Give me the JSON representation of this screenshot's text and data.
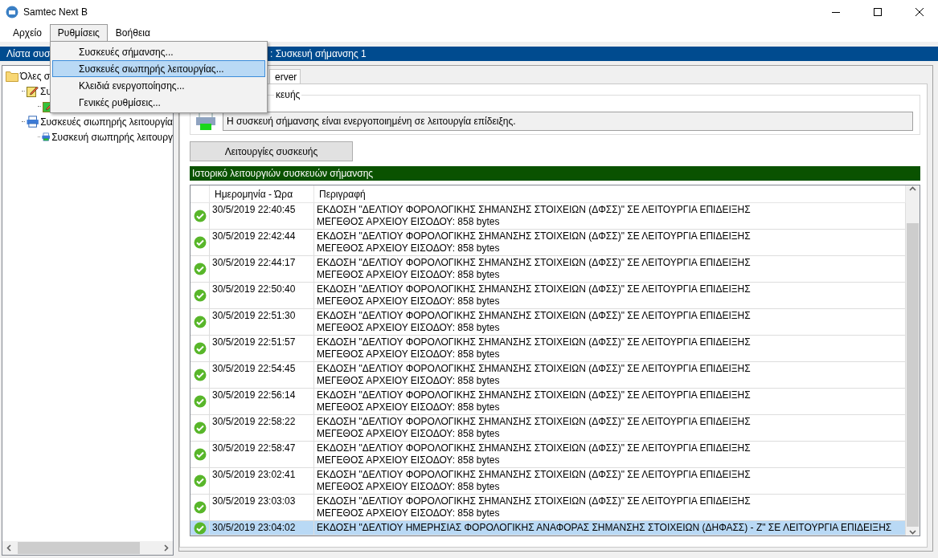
{
  "window": {
    "title": "Samtec Next B"
  },
  "menubar": [
    {
      "label": "Αρχείο",
      "selected": false
    },
    {
      "label": "Ρυθμίσεις",
      "selected": true
    },
    {
      "label": "Βοήθεια",
      "selected": false
    }
  ],
  "open_menu": [
    {
      "label": "Συσκευές σήμανσης...",
      "selected": false
    },
    {
      "label": "Συσκευές σιωπηρής λειτουργίας...",
      "selected": true
    },
    {
      "label": "Κλειδιά ενεργοποίησης...",
      "selected": false
    },
    {
      "label": "Γενικές ρυθμίσεις...",
      "selected": false
    }
  ],
  "left_panel": {
    "header": "Λίστα συσ",
    "tree": [
      {
        "label": "Όλες σ",
        "kind": "folder",
        "children": [
          {
            "label": "Συ",
            "kind": "note",
            "children": [
              {
                "kind": "note-green"
              }
            ]
          },
          {
            "label": "Συσκευές σιωπηρής λειτουργία",
            "kind": "printer",
            "children": [
              {
                "label": "Συσκευή σιωπηρής λειτουργ",
                "kind": "printer-green"
              }
            ]
          }
        ]
      }
    ]
  },
  "right_panel": {
    "header": ": Συσκευή σήμανσης 1",
    "tabs": [
      {
        "label": "erver",
        "selected": true
      }
    ],
    "group": {
      "label": "κευής",
      "message": "Η συσκευή σήμανσης είναι ενεργοποιημένη σε λειτουργία επίδειξης."
    },
    "button": "Λειτουργίες συσκευής",
    "history": {
      "title": "Ιστορικό λειτουργιών συσκευών σήμανσης",
      "columns": [
        "Ημερομηνία - Ώρα",
        "Περιγραφή"
      ],
      "rows": [
        {
          "time": "30/5/2019 22:40:45",
          "description": "ΕΚΔΟΣΗ \"ΔΕΛΤΙΟΥ ΦΟΡΟΛΟΓΙΚΗΣ ΣΗΜΑΝΣΗΣ ΣΤΟΙΧΕΙΩΝ (ΔΦΣΣ)\" ΣΕ ΛΕΙΤΟΥΡΓΙΑ ΕΠΙΔΕΙΞΗΣ",
          "detail": "ΜΕΓΕΘΟΣ ΑΡΧΕΙΟΥ ΕΙΣΟΔΟΥ: 858 bytes",
          "selected": false
        },
        {
          "time": "30/5/2019 22:42:44",
          "description": "ΕΚΔΟΣΗ \"ΔΕΛΤΙΟΥ ΦΟΡΟΛΟΓΙΚΗΣ ΣΗΜΑΝΣΗΣ ΣΤΟΙΧΕΙΩΝ (ΔΦΣΣ)\" ΣΕ ΛΕΙΤΟΥΡΓΙΑ ΕΠΙΔΕΙΞΗΣ",
          "detail": "ΜΕΓΕΘΟΣ ΑΡΧΕΙΟΥ ΕΙΣΟΔΟΥ: 858 bytes",
          "selected": false
        },
        {
          "time": "30/5/2019 22:44:17",
          "description": "ΕΚΔΟΣΗ \"ΔΕΛΤΙΟΥ ΦΟΡΟΛΟΓΙΚΗΣ ΣΗΜΑΝΣΗΣ ΣΤΟΙΧΕΙΩΝ (ΔΦΣΣ)\" ΣΕ ΛΕΙΤΟΥΡΓΙΑ ΕΠΙΔΕΙΞΗΣ",
          "detail": "ΜΕΓΕΘΟΣ ΑΡΧΕΙΟΥ ΕΙΣΟΔΟΥ: 858 bytes",
          "selected": false
        },
        {
          "time": "30/5/2019 22:50:40",
          "description": "ΕΚΔΟΣΗ \"ΔΕΛΤΙΟΥ ΦΟΡΟΛΟΓΙΚΗΣ ΣΗΜΑΝΣΗΣ ΣΤΟΙΧΕΙΩΝ (ΔΦΣΣ)\" ΣΕ ΛΕΙΤΟΥΡΓΙΑ ΕΠΙΔΕΙΞΗΣ",
          "detail": "ΜΕΓΕΘΟΣ ΑΡΧΕΙΟΥ ΕΙΣΟΔΟΥ: 858 bytes",
          "selected": false
        },
        {
          "time": "30/5/2019 22:51:30",
          "description": "ΕΚΔΟΣΗ \"ΔΕΛΤΙΟΥ ΦΟΡΟΛΟΓΙΚΗΣ ΣΗΜΑΝΣΗΣ ΣΤΟΙΧΕΙΩΝ (ΔΦΣΣ)\" ΣΕ ΛΕΙΤΟΥΡΓΙΑ ΕΠΙΔΕΙΞΗΣ",
          "detail": "ΜΕΓΕΘΟΣ ΑΡΧΕΙΟΥ ΕΙΣΟΔΟΥ: 858 bytes",
          "selected": false
        },
        {
          "time": "30/5/2019 22:51:57",
          "description": "ΕΚΔΟΣΗ \"ΔΕΛΤΙΟΥ ΦΟΡΟΛΟΓΙΚΗΣ ΣΗΜΑΝΣΗΣ ΣΤΟΙΧΕΙΩΝ (ΔΦΣΣ)\" ΣΕ ΛΕΙΤΟΥΡΓΙΑ ΕΠΙΔΕΙΞΗΣ",
          "detail": "ΜΕΓΕΘΟΣ ΑΡΧΕΙΟΥ ΕΙΣΟΔΟΥ: 858 bytes",
          "selected": false
        },
        {
          "time": "30/5/2019 22:54:45",
          "description": "ΕΚΔΟΣΗ \"ΔΕΛΤΙΟΥ ΦΟΡΟΛΟΓΙΚΗΣ ΣΗΜΑΝΣΗΣ ΣΤΟΙΧΕΙΩΝ (ΔΦΣΣ)\" ΣΕ ΛΕΙΤΟΥΡΓΙΑ ΕΠΙΔΕΙΞΗΣ",
          "detail": "ΜΕΓΕΘΟΣ ΑΡΧΕΙΟΥ ΕΙΣΟΔΟΥ: 858 bytes",
          "selected": false
        },
        {
          "time": "30/5/2019 22:56:14",
          "description": "ΕΚΔΟΣΗ \"ΔΕΛΤΙΟΥ ΦΟΡΟΛΟΓΙΚΗΣ ΣΗΜΑΝΣΗΣ ΣΤΟΙΧΕΙΩΝ (ΔΦΣΣ)\" ΣΕ ΛΕΙΤΟΥΡΓΙΑ ΕΠΙΔΕΙΞΗΣ",
          "detail": "ΜΕΓΕΘΟΣ ΑΡΧΕΙΟΥ ΕΙΣΟΔΟΥ: 858 bytes",
          "selected": false
        },
        {
          "time": "30/5/2019 22:58:22",
          "description": "ΕΚΔΟΣΗ \"ΔΕΛΤΙΟΥ ΦΟΡΟΛΟΓΙΚΗΣ ΣΗΜΑΝΣΗΣ ΣΤΟΙΧΕΙΩΝ (ΔΦΣΣ)\" ΣΕ ΛΕΙΤΟΥΡΓΙΑ ΕΠΙΔΕΙΞΗΣ",
          "detail": "ΜΕΓΕΘΟΣ ΑΡΧΕΙΟΥ ΕΙΣΟΔΟΥ: 858 bytes",
          "selected": false
        },
        {
          "time": "30/5/2019 22:58:47",
          "description": "ΕΚΔΟΣΗ \"ΔΕΛΤΙΟΥ ΦΟΡΟΛΟΓΙΚΗΣ ΣΗΜΑΝΣΗΣ ΣΤΟΙΧΕΙΩΝ (ΔΦΣΣ)\" ΣΕ ΛΕΙΤΟΥΡΓΙΑ ΕΠΙΔΕΙΞΗΣ",
          "detail": "ΜΕΓΕΘΟΣ ΑΡΧΕΙΟΥ ΕΙΣΟΔΟΥ: 858 bytes",
          "selected": false
        },
        {
          "time": "30/5/2019 23:02:41",
          "description": "ΕΚΔΟΣΗ \"ΔΕΛΤΙΟΥ ΦΟΡΟΛΟΓΙΚΗΣ ΣΗΜΑΝΣΗΣ ΣΤΟΙΧΕΙΩΝ (ΔΦΣΣ)\" ΣΕ ΛΕΙΤΟΥΡΓΙΑ ΕΠΙΔΕΙΞΗΣ",
          "detail": "ΜΕΓΕΘΟΣ ΑΡΧΕΙΟΥ ΕΙΣΟΔΟΥ: 858 bytes",
          "selected": false
        },
        {
          "time": "30/5/2019 23:03:03",
          "description": "ΕΚΔΟΣΗ \"ΔΕΛΤΙΟΥ ΦΟΡΟΛΟΓΙΚΗΣ ΣΗΜΑΝΣΗΣ ΣΤΟΙΧΕΙΩΝ (ΔΦΣΣ)\" ΣΕ ΛΕΙΤΟΥΡΓΙΑ ΕΠΙΔΕΙΞΗΣ",
          "detail": "ΜΕΓΕΘΟΣ ΑΡΧΕΙΟΥ ΕΙΣΟΔΟΥ: 858 bytes",
          "selected": false
        },
        {
          "time": "30/5/2019 23:04:02",
          "description": "ΕΚΔΟΣΗ \"ΔΕΛΤΙΟΥ ΗΜΕΡΗΣΙΑΣ ΦΟΡΟΛΟΓΙΚΗΣ ΑΝΑΦΟΡΑΣ ΣΗΜΑΝΣΗΣ ΣΤΟΙΧΕΙΩΝ (ΔΗΦΑΣΣ) - Ζ\" ΣΕ ΛΕΙΤΟΥΡΓΙΑ ΕΠΙΔΕΙΞΗΣ",
          "selected": true
        }
      ]
    }
  }
}
